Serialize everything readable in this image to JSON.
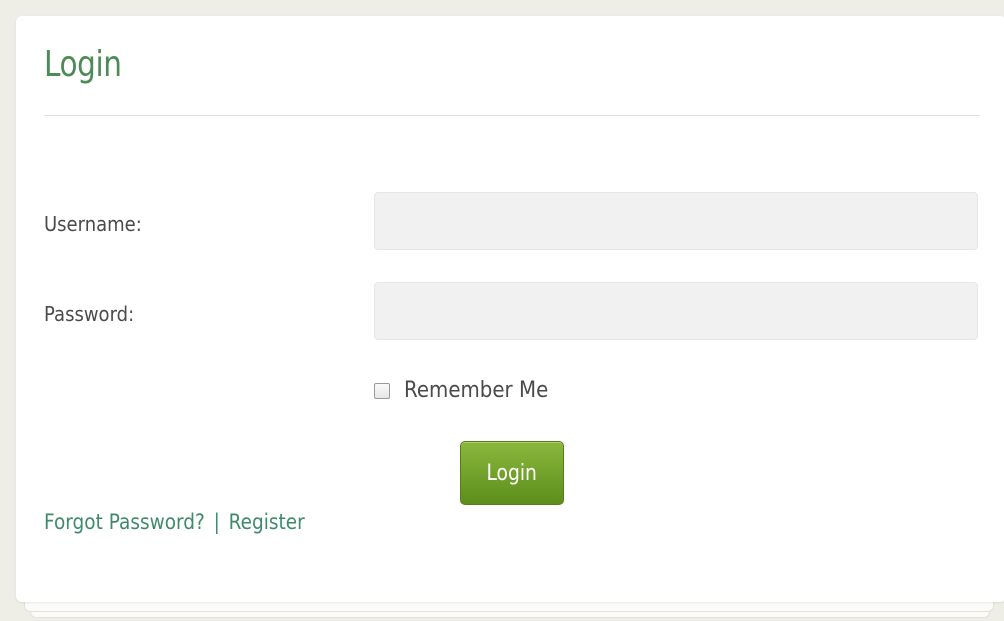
{
  "page": {
    "title": "Login"
  },
  "form": {
    "username_label": "Username:",
    "username_value": "",
    "password_label": "Password:",
    "password_value": "",
    "remember_label": "Remember Me",
    "remember_checked": false,
    "login_button": "Login"
  },
  "links": {
    "forgot_password": "Forgot Password?",
    "separator": "|",
    "register": "Register"
  },
  "colors": {
    "title": "#4e8a58",
    "link": "#3f8a6a",
    "button_top": "#8ab83c",
    "button_bottom": "#5c8e1c",
    "background": "#eeeee6"
  }
}
